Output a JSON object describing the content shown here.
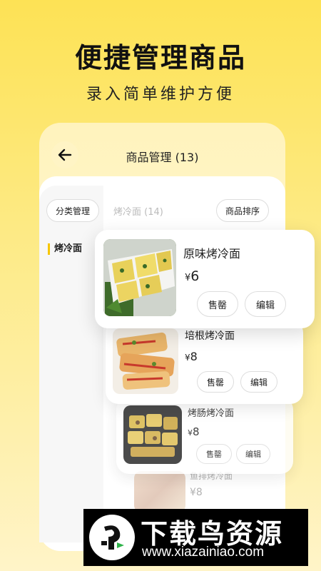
{
  "hero": {
    "title": "便捷管理商品",
    "subtitle": "录入简单维护方便"
  },
  "header": {
    "title": "商品管理 (13)"
  },
  "toolbar": {
    "category_manage_label": "分类管理",
    "sort_label": "商品排序"
  },
  "category": {
    "current_title": "烤冷面 (14)",
    "active_sidebar_item": "烤冷面"
  },
  "products": [
    {
      "name": "原味烤冷面",
      "price": "6",
      "currency": "¥",
      "sold_out_label": "售罄",
      "edit_label": "编辑"
    },
    {
      "name": "培根烤冷面",
      "price": "8",
      "currency": "¥",
      "sold_out_label": "售罄",
      "edit_label": "编辑"
    },
    {
      "name": "烤肠烤冷面",
      "price": "8",
      "currency": "¥",
      "sold_out_label": "售罄",
      "edit_label": "编辑"
    },
    {
      "name": "鱼排烤冷面",
      "price": "8",
      "currency": "¥"
    }
  ],
  "watermark": {
    "title": "下载鸟资源",
    "url": "www.xiazainiao.com"
  },
  "colors": {
    "brand_yellow": "#fde255",
    "accent_bar": "#f7c600"
  }
}
